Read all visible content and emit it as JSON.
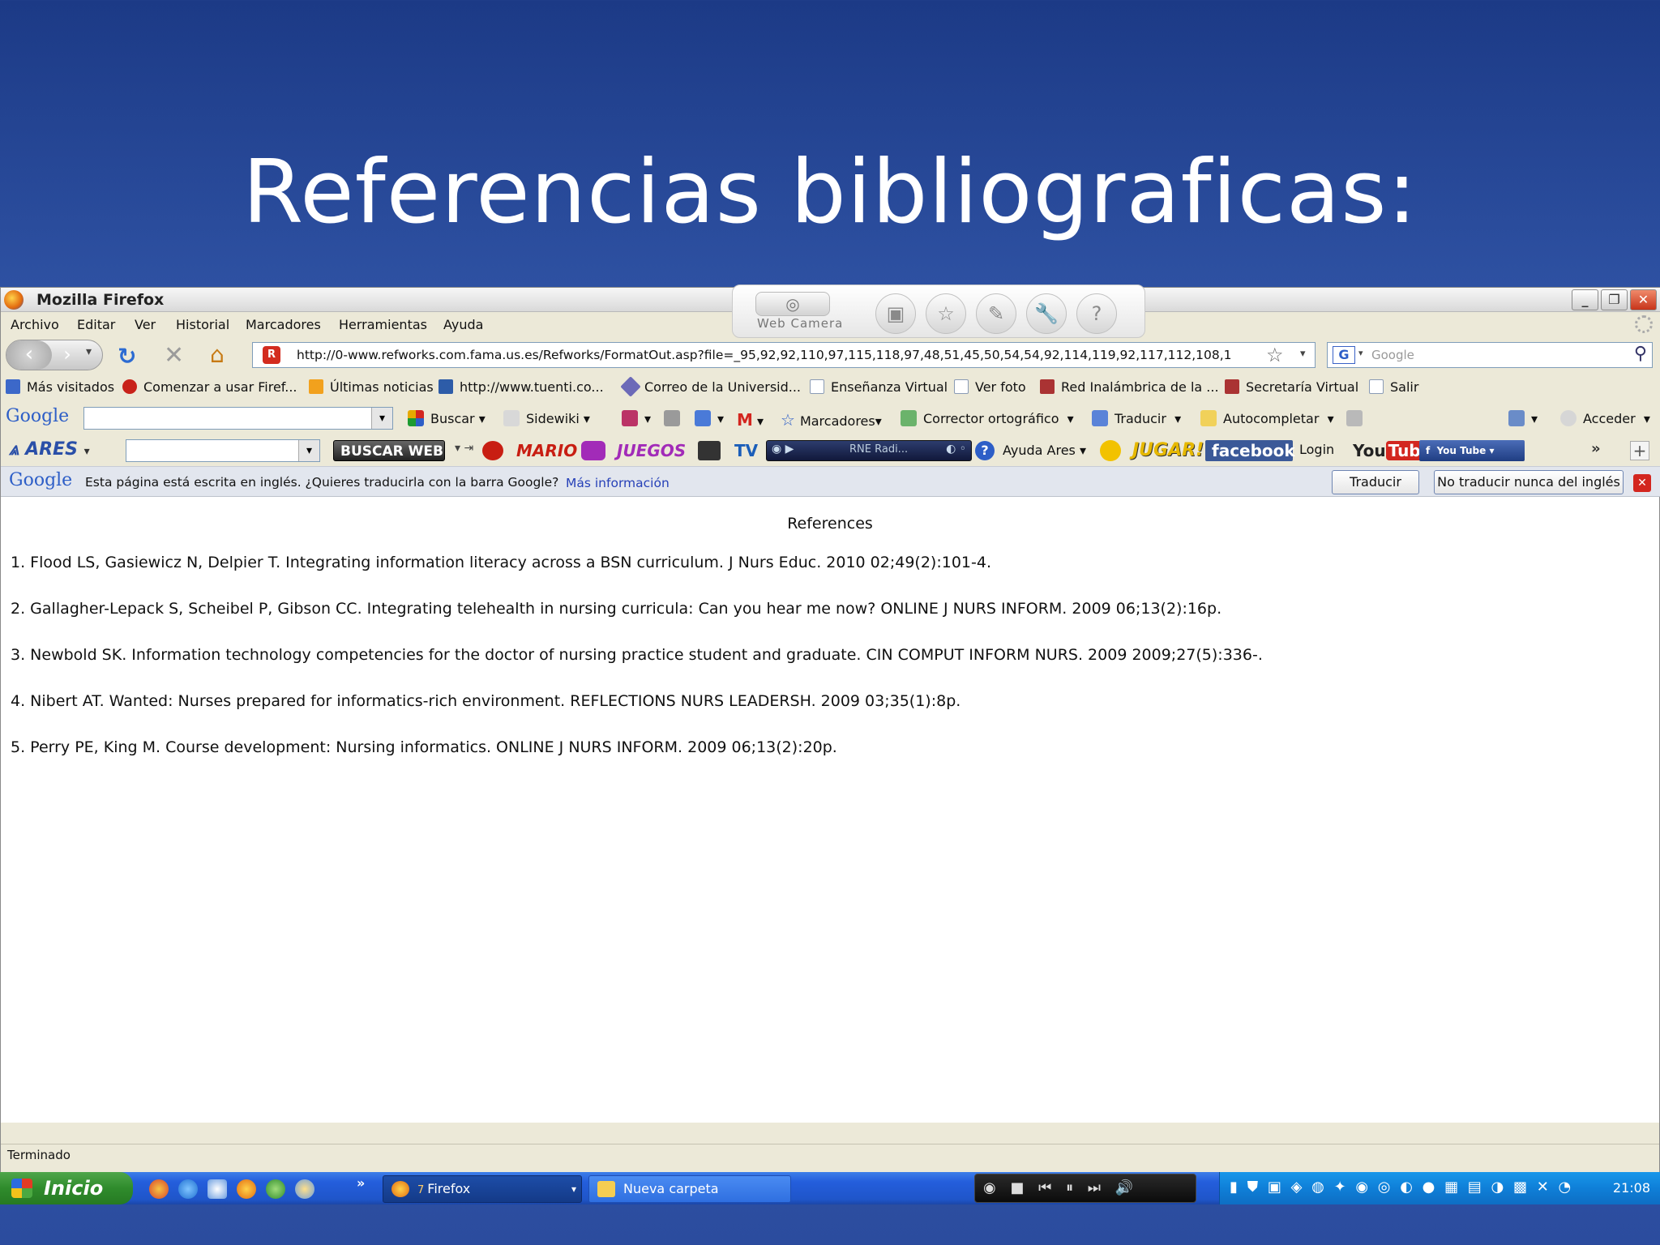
{
  "slide": {
    "title": "Referencias bibliograficas:"
  },
  "window": {
    "title": "Mozilla Firefox"
  },
  "webcam": {
    "label": "Web Camera",
    "icons": [
      "camera-icon",
      "contact-icon",
      "star-icon",
      "edit-icon",
      "wrench-icon",
      "help-icon"
    ]
  },
  "menu": [
    "Archivo",
    "Editar",
    "Ver",
    "Historial",
    "Marcadores",
    "Herramientas",
    "Ayuda"
  ],
  "nav": {
    "url": "http://0-www.refworks.com.fama.us.es/Refworks/FormatOut.asp?file=_95,92,92,110,97,115,118,97,48,51,45,50,54,54,92,114,119,92,117,112,108,1",
    "search_placeholder": "Google"
  },
  "bookmarks": [
    "Más visitados",
    "Comenzar a usar Firef...",
    "Últimas noticias",
    "http://www.tuenti.co...",
    "Correo de la Universid...",
    "Enseñanza Virtual",
    "Ver foto",
    "Red Inalámbrica de la ...",
    "Secretaría Virtual",
    "Salir"
  ],
  "google_toolbar": {
    "logo": "Google",
    "buscar": "Buscar",
    "sidewiki": "Sidewiki",
    "marcadores": "Marcadores",
    "corrector": "Corrector ortográfico",
    "traducir": "Traducir",
    "autocompletar": "Autocompletar",
    "acceder": "Acceder"
  },
  "ares_toolbar": {
    "logo": "ARES",
    "buscar_web": "BUSCAR WEB",
    "mario": "MARIO",
    "juegos": "JUEGOS",
    "tv": "TV",
    "radio": "RNE Radi...",
    "ayuda": "Ayuda Ares",
    "jugar": "JUGAR!",
    "facebook": "facebook",
    "login": "Login",
    "youtube_you": "You",
    "youtube_tube": "Tube",
    "fb_yt": "You Tube"
  },
  "translate_bar": {
    "logo": "Google",
    "message": "Esta página está escrita en inglés. ¿Quieres traducirla con la barra Google?",
    "more_info": "Más información",
    "translate_btn": "Traducir",
    "never_btn": "No traducir nunca del inglés"
  },
  "content": {
    "heading": "References",
    "references": [
      "1. Flood LS, Gasiewicz N, Delpier T. Integrating information literacy across a BSN curriculum. J Nurs Educ. 2010 02;49(2):101-4.",
      "2. Gallagher-Lepack S, Scheibel P, Gibson CC. Integrating telehealth in nursing curricula: Can you hear me now? ONLINE J NURS INFORM. 2009 06;13(2):16p.",
      "3. Newbold SK. Information technology competencies for the doctor of nursing practice student and graduate. CIN COMPUT INFORM NURS. 2009 2009;27(5):336-.",
      "4. Nibert AT. Wanted: Nurses prepared for informatics-rich environment. REFLECTIONS NURS LEADERSH. 2009 03;35(1):8p.",
      "5. Perry PE, King M. Course development: Nursing informatics. ONLINE J NURS INFORM. 2009 06;13(2):20p."
    ]
  },
  "status": {
    "text": "Terminado"
  },
  "taskbar": {
    "start": "Inicio",
    "more": "»",
    "firefox": "Firefox",
    "firefox_count": "7",
    "folder": "Nueva carpeta",
    "clock": "21:08"
  }
}
